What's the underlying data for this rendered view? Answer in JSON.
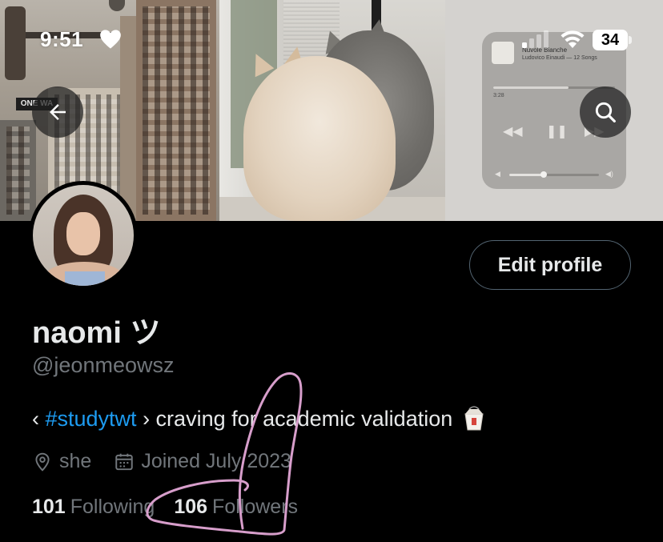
{
  "status_bar": {
    "time": "9:51",
    "battery": "34"
  },
  "banner": {
    "street_sign": "ONE WA",
    "music_widget": {
      "song": "Nuvole Bianche",
      "artist": "Ludovico Einaudi — 12 Songs",
      "elapsed": "3:28",
      "progress_fraction": 0.62,
      "volume_fraction": 0.38
    }
  },
  "profile": {
    "display_name": "naomi ツ",
    "handle": "@jeonmeowsz",
    "bio": {
      "prefix": "‹ ",
      "hashtag": "#studytwt",
      "suffix": " › craving for academic validation"
    },
    "pronouns": "she",
    "joined": "Joined July 2023",
    "following_count": "101",
    "following_label": "Following",
    "followers_count": "106",
    "followers_label": "Followers",
    "edit_button": "Edit profile"
  },
  "icons": {
    "back": "arrow-left-icon",
    "search": "search-icon",
    "location": "location-pin-icon",
    "calendar": "calendar-icon",
    "bio_emoji": "takeout-box-icon",
    "status_heart": "heart-icon"
  },
  "colors": {
    "background": "#000000",
    "primary_text": "#e7e9ea",
    "secondary_text": "#71767b",
    "hashtag": "#1d9bf0",
    "button_border": "#536471",
    "doodle": "#e3a6d6"
  }
}
